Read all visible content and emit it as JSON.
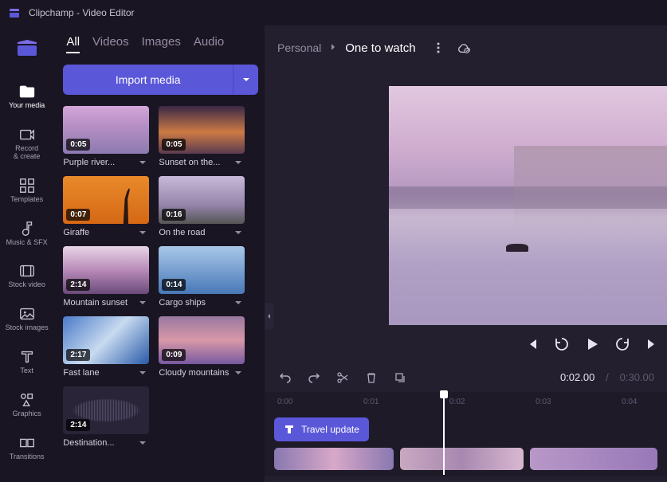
{
  "titlebar": {
    "app_name": "Clipchamp - Video Editor"
  },
  "sidebar": {
    "items": [
      {
        "label": "Your media"
      },
      {
        "label": "Record\n& create"
      },
      {
        "label": "Templates"
      },
      {
        "label": "Music & SFX"
      },
      {
        "label": "Stock video"
      },
      {
        "label": "Stock images"
      },
      {
        "label": "Text"
      },
      {
        "label": "Graphics"
      },
      {
        "label": "Transitions"
      }
    ]
  },
  "media_panel": {
    "tabs": {
      "all": "All",
      "videos": "Videos",
      "images": "Images",
      "audio": "Audio"
    },
    "import_label": "Import media",
    "clips": [
      {
        "name": "Purple river...",
        "duration": "0:05"
      },
      {
        "name": "Sunset on the...",
        "duration": "0:05"
      },
      {
        "name": "Giraffe",
        "duration": "0:07"
      },
      {
        "name": "On the road",
        "duration": "0:16"
      },
      {
        "name": "Mountain sunset",
        "duration": "2:14"
      },
      {
        "name": "Cargo ships",
        "duration": "0:14"
      },
      {
        "name": "Fast lane",
        "duration": "2:17"
      },
      {
        "name": "Cloudy mountains",
        "duration": "0:09"
      },
      {
        "name": "Destination...",
        "duration": "2:14"
      }
    ]
  },
  "breadcrumb": {
    "parent": "Personal",
    "current": "One to watch"
  },
  "timeline": {
    "current_time": "0:02.00",
    "total_time": "0:30.00",
    "ruler": [
      "0:00",
      "0:01",
      "0:02",
      "0:03",
      "0:04"
    ],
    "text_clip_label": "Travel update"
  }
}
